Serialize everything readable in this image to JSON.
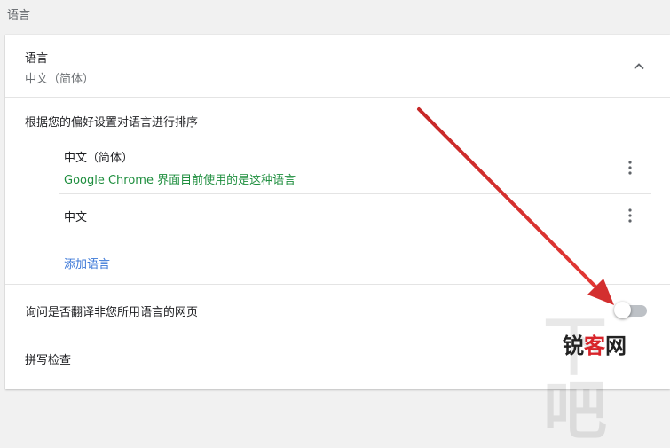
{
  "section": {
    "title": "语言"
  },
  "language_card": {
    "header_title": "语言",
    "header_subtitle": "中文（简体）",
    "expand_icon": "chevron-up-icon",
    "sort_instruction": "根据您的偏好设置对语言进行排序",
    "languages": [
      {
        "name": "中文（简体）",
        "note": "Google Chrome 界面目前使用的是这种语言",
        "menu_icon": "more-vert-icon"
      },
      {
        "name": "中文",
        "menu_icon": "more-vert-icon"
      }
    ],
    "add_language_label": "添加语言",
    "translate_prompt": {
      "label": "询问是否翻译非您所用语言的网页",
      "enabled": false
    },
    "spellcheck_label": "拼写检查"
  },
  "overlay": {
    "arrow_color": "#d32f2f"
  },
  "watermark": {
    "brand_text_before": "锐",
    "brand_text_accent": "客",
    "brand_text_after": "网",
    "backdrop_glyphs": "下吧"
  },
  "colors": {
    "link": "#3c78d8",
    "note_green": "#1e8e3e",
    "toggle_off_track": "#bdc1c6"
  }
}
